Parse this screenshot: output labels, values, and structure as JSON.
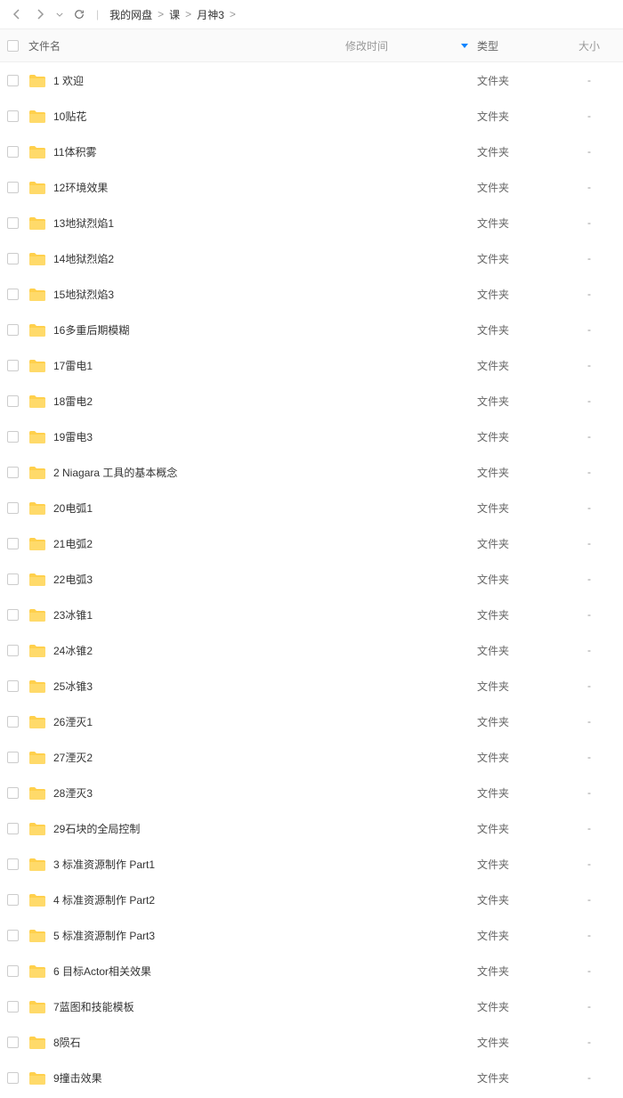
{
  "breadcrumb": {
    "items": [
      "我的网盘",
      "课",
      "月神3"
    ]
  },
  "columns": {
    "name": "文件名",
    "mtime": "修改时间",
    "type": "类型",
    "size": "大小"
  },
  "type_folder": "文件夹",
  "size_placeholder": "-",
  "files": [
    {
      "name": "1 欢迎"
    },
    {
      "name": "10贴花"
    },
    {
      "name": "11体积雾"
    },
    {
      "name": "12环境效果"
    },
    {
      "name": "13地狱烈焰1"
    },
    {
      "name": "14地狱烈焰2"
    },
    {
      "name": "15地狱烈焰3"
    },
    {
      "name": "16多重后期模糊"
    },
    {
      "name": "17雷电1"
    },
    {
      "name": "18雷电2"
    },
    {
      "name": "19雷电3"
    },
    {
      "name": "2 Niagara 工具的基本概念"
    },
    {
      "name": "20电弧1"
    },
    {
      "name": "21电弧2"
    },
    {
      "name": "22电弧3"
    },
    {
      "name": "23冰锥1"
    },
    {
      "name": "24冰锥2"
    },
    {
      "name": "25冰锥3"
    },
    {
      "name": "26湮灭1"
    },
    {
      "name": "27湮灭2"
    },
    {
      "name": "28湮灭3"
    },
    {
      "name": "29石块的全局控制"
    },
    {
      "name": "3 标准资源制作 Part1"
    },
    {
      "name": "4 标准资源制作 Part2"
    },
    {
      "name": "5 标准资源制作 Part3"
    },
    {
      "name": "6 目标Actor相关效果"
    },
    {
      "name": "7蓝图和技能模板"
    },
    {
      "name": "8陨石"
    },
    {
      "name": "9撞击效果"
    }
  ]
}
